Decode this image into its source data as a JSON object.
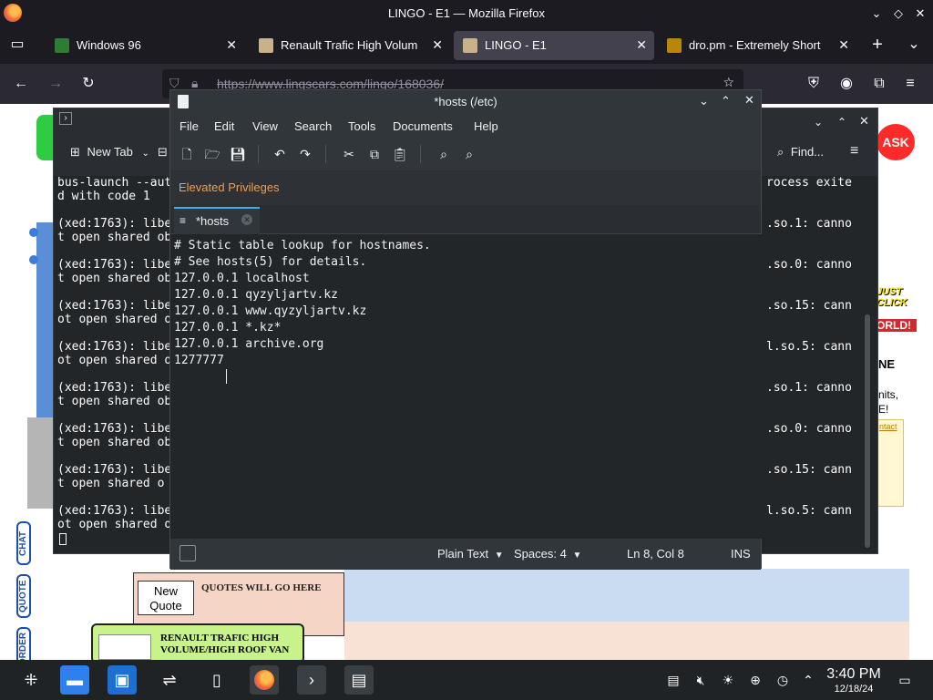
{
  "window": {
    "title": "LINGO - E1 — Mozilla Firefox"
  },
  "tabs": [
    {
      "label": "Windows 96",
      "icon": "windows96-favicon"
    },
    {
      "label": "Renault Trafic High Volum",
      "icon": "renault-favicon"
    },
    {
      "label": "LINGO - E1",
      "icon": "lingo-favicon",
      "active": true
    },
    {
      "label": "dro.pm - Extremely Short",
      "icon": "folder-favicon"
    }
  ],
  "urlbar": {
    "url": "https://www.lingscars.com/lingo/168036/"
  },
  "terminal": {
    "toolbar": {
      "new_tab": "New Tab",
      "find": "Find..."
    },
    "left_lines": [
      "bus-launch --aut",
      "d with code 1",
      "",
      "(xed:1763): libe",
      "t open shared ob",
      "",
      "(xed:1763): libe",
      "t open shared ob",
      "",
      "(xed:1763): libe",
      "ot open shared o",
      "",
      "(xed:1763): libe",
      "ot open shared o",
      "",
      "(xed:1763): libe",
      "t open shared ob",
      "",
      "(xed:1763): libe",
      "t open shared ob",
      "",
      "(xed:1763): libe",
      "t open shared o",
      "",
      "(xed:1763): libe",
      "ot open shared o"
    ],
    "right_lines": [
      "rocess exite",
      "",
      "",
      ".so.1: canno",
      "",
      "",
      ".so.0: canno",
      "",
      "",
      ".so.15: cann",
      "",
      "",
      "l.so.5: cann",
      "",
      "",
      ".so.1: canno",
      "",
      "",
      ".so.0: canno",
      "",
      "",
      ".so.15: cann",
      "",
      "",
      "l.so.5: cann"
    ]
  },
  "editor": {
    "title": "*hosts (/etc)",
    "menu": [
      "File",
      "Edit",
      "View",
      "Search",
      "Tools",
      "Documents",
      "Help"
    ],
    "banner": "Elevated Privileges",
    "tab_label": "*hosts",
    "lines": [
      "# Static table lookup for hostnames.",
      "# See hosts(5) for details.",
      "127.0.0.1 localhost",
      "127.0.0.1 qyzyljartv.kz",
      "127.0.0.1 www.qyzyljartv.kz",
      "127.0.0.1 *.kz*",
      "127.0.0.1 archive.org",
      "1277777"
    ],
    "status": {
      "language": "Plain Text",
      "spaces": "Spaces: 4",
      "position": "Ln 8, Col 8",
      "mode": "INS"
    }
  },
  "webpage": {
    "new_quote": "New\nQuote",
    "quotes_text": "QUOTES WILL GO HERE",
    "renault_text": "RENAULT TRAFIC HIGH VOLUME/HIGH ROOF VAN",
    "side_nav": [
      "CHAT",
      "QUOTE",
      "ORDER"
    ],
    "ask": "ASK",
    "just_click": "JUST CLICK",
    "world": "ORLD!",
    "ne": "NE",
    "nits": "nits,",
    "e1": "E!",
    "ntact": "ntact"
  },
  "taskbar": {
    "time": "3:40 PM",
    "date": "12/18/24"
  },
  "colors": {
    "accent": "#3daee9",
    "privilege": "#f39c4b"
  }
}
